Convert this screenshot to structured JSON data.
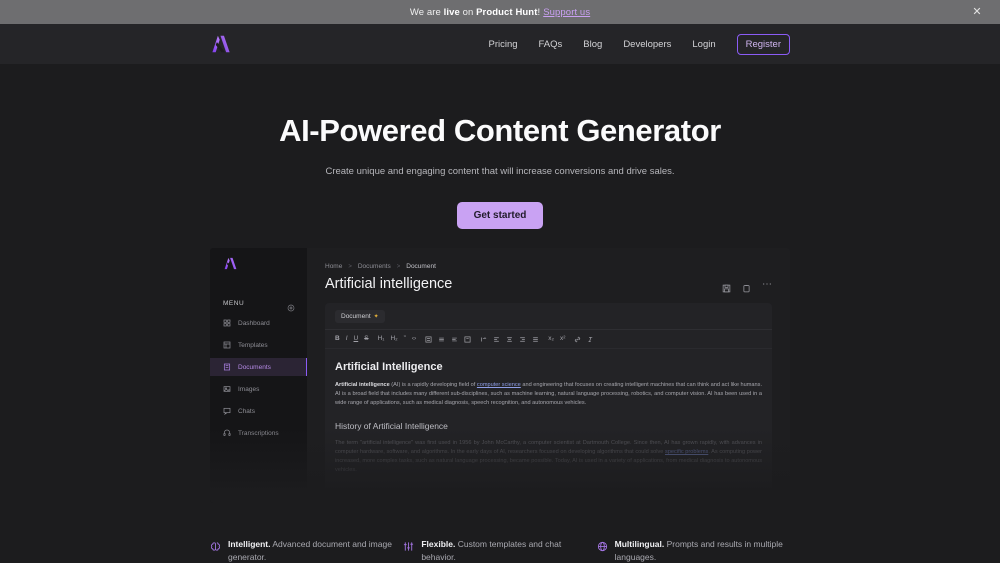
{
  "banner": {
    "prefix": "We are ",
    "live": "live",
    "mid": " on ",
    "product": "Product Hunt",
    "suffix": "!",
    "support": "Support us",
    "close_icon": "close-icon"
  },
  "header": {
    "logo_alt": "logo-icon",
    "nav": [
      {
        "label": "Pricing"
      },
      {
        "label": "FAQs"
      },
      {
        "label": "Blog"
      },
      {
        "label": "Developers"
      },
      {
        "label": "Login"
      }
    ],
    "register_label": "Register"
  },
  "hero": {
    "title": "AI-Powered Content Generator",
    "subtitle": "Create unique and engaging content that will increase conversions and drive sales.",
    "cta_label": "Get started"
  },
  "app": {
    "sidebar": {
      "menu_label": "MENU",
      "gear_icon": "gear-icon",
      "items": [
        {
          "label": "Dashboard",
          "icon": "dashboard-icon",
          "active": false
        },
        {
          "label": "Templates",
          "icon": "templates-icon",
          "active": false
        },
        {
          "label": "Documents",
          "icon": "documents-icon",
          "active": true
        },
        {
          "label": "Images",
          "icon": "images-icon",
          "active": false
        },
        {
          "label": "Chats",
          "icon": "chats-icon",
          "active": false
        },
        {
          "label": "Transcriptions",
          "icon": "transcriptions-icon",
          "active": false
        }
      ]
    },
    "breadcrumb": {
      "home": "Home",
      "documents": "Documents",
      "current": "Document",
      "separator": ">"
    },
    "document_title": "Artificial intelligence",
    "actions": [
      {
        "name": "save-icon"
      },
      {
        "name": "copy-icon"
      },
      {
        "name": "more-icon",
        "glyph": "⋯"
      }
    ],
    "tab_label": "Document",
    "tab_star": "✦",
    "toolbar": {
      "group1": [
        "B",
        "I",
        "U",
        "S"
      ],
      "group2": [
        "H₁",
        "H₂",
        "”",
        "‹›"
      ],
      "group3": [
        "list-ordered-icon",
        "list-bullet-icon",
        "list-check-icon",
        "list-indent-icon"
      ],
      "group4": [
        "align-justify-icon",
        "align-left-icon",
        "align-center-icon",
        "align-right-icon",
        "align-block-icon"
      ],
      "group5": [
        "x₂",
        "x²"
      ],
      "group6": [
        "link-icon",
        "clear-format-icon"
      ]
    },
    "doc": {
      "h2": "Artificial Intelligence",
      "p1_bold": "Artificial intelligence",
      "p1_a": " (AI) is a rapidly developing field of ",
      "p1_link": "computer science",
      "p1_b": " and engineering that focuses on creating intelligent machines that can think and act like humans. AI is a broad field that includes many different sub-disciplines, such as machine learning, natural language processing, robotics, and computer vision. AI has been used in a wide range of applications, such as medical diagnosis, speech recognition, and autonomous vehicles.",
      "h3": "History of Artificial Intelligence",
      "p2_a": "The term \"artificial intelligence\" was first used in 1956 by John McCarthy, a computer scientist at Dartmouth College. Since then, AI has grown rapidly, with advances in computer hardware, software, and algorithms. In the early days of AI, researchers focused on developing algorithms that could solve ",
      "p2_link": "specific problems",
      "p2_b": ". As computing power increased, more complex tasks, such as natural language processing, became possible. Today, AI is used in a variety of applications, from medical diagnosis to autonomous vehicles."
    }
  },
  "features": [
    {
      "icon": "brain-icon",
      "title": "Intelligent.",
      "text": " Advanced document and image generator."
    },
    {
      "icon": "sliders-icon",
      "title": "Flexible.",
      "text": " Custom templates and chat behavior."
    },
    {
      "icon": "globe-icon",
      "title": "Multilingual.",
      "text": " Prompts and results in multiple languages."
    }
  ],
  "colors": {
    "accent": "#8b5cf6",
    "cta": "#c9a2f3",
    "background": "#1c1c1e",
    "banner": "#6e6e70"
  }
}
